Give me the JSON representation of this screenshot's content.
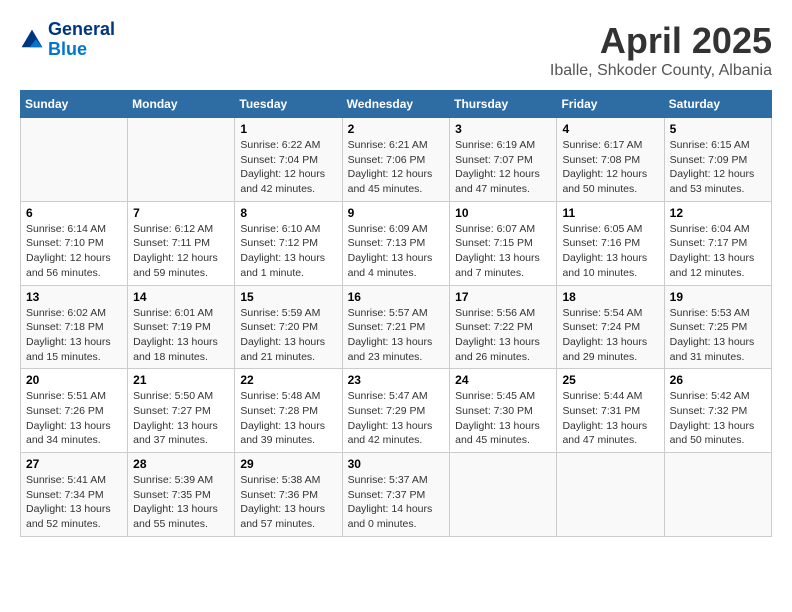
{
  "logo": {
    "line1": "General",
    "line2": "Blue"
  },
  "title": "April 2025",
  "location": "Iballe, Shkoder County, Albania",
  "days_header": [
    "Sunday",
    "Monday",
    "Tuesday",
    "Wednesday",
    "Thursday",
    "Friday",
    "Saturday"
  ],
  "weeks": [
    [
      {
        "day": "",
        "info": ""
      },
      {
        "day": "",
        "info": ""
      },
      {
        "day": "1",
        "info": "Sunrise: 6:22 AM\nSunset: 7:04 PM\nDaylight: 12 hours and 42 minutes."
      },
      {
        "day": "2",
        "info": "Sunrise: 6:21 AM\nSunset: 7:06 PM\nDaylight: 12 hours and 45 minutes."
      },
      {
        "day": "3",
        "info": "Sunrise: 6:19 AM\nSunset: 7:07 PM\nDaylight: 12 hours and 47 minutes."
      },
      {
        "day": "4",
        "info": "Sunrise: 6:17 AM\nSunset: 7:08 PM\nDaylight: 12 hours and 50 minutes."
      },
      {
        "day": "5",
        "info": "Sunrise: 6:15 AM\nSunset: 7:09 PM\nDaylight: 12 hours and 53 minutes."
      }
    ],
    [
      {
        "day": "6",
        "info": "Sunrise: 6:14 AM\nSunset: 7:10 PM\nDaylight: 12 hours and 56 minutes."
      },
      {
        "day": "7",
        "info": "Sunrise: 6:12 AM\nSunset: 7:11 PM\nDaylight: 12 hours and 59 minutes."
      },
      {
        "day": "8",
        "info": "Sunrise: 6:10 AM\nSunset: 7:12 PM\nDaylight: 13 hours and 1 minute."
      },
      {
        "day": "9",
        "info": "Sunrise: 6:09 AM\nSunset: 7:13 PM\nDaylight: 13 hours and 4 minutes."
      },
      {
        "day": "10",
        "info": "Sunrise: 6:07 AM\nSunset: 7:15 PM\nDaylight: 13 hours and 7 minutes."
      },
      {
        "day": "11",
        "info": "Sunrise: 6:05 AM\nSunset: 7:16 PM\nDaylight: 13 hours and 10 minutes."
      },
      {
        "day": "12",
        "info": "Sunrise: 6:04 AM\nSunset: 7:17 PM\nDaylight: 13 hours and 12 minutes."
      }
    ],
    [
      {
        "day": "13",
        "info": "Sunrise: 6:02 AM\nSunset: 7:18 PM\nDaylight: 13 hours and 15 minutes."
      },
      {
        "day": "14",
        "info": "Sunrise: 6:01 AM\nSunset: 7:19 PM\nDaylight: 13 hours and 18 minutes."
      },
      {
        "day": "15",
        "info": "Sunrise: 5:59 AM\nSunset: 7:20 PM\nDaylight: 13 hours and 21 minutes."
      },
      {
        "day": "16",
        "info": "Sunrise: 5:57 AM\nSunset: 7:21 PM\nDaylight: 13 hours and 23 minutes."
      },
      {
        "day": "17",
        "info": "Sunrise: 5:56 AM\nSunset: 7:22 PM\nDaylight: 13 hours and 26 minutes."
      },
      {
        "day": "18",
        "info": "Sunrise: 5:54 AM\nSunset: 7:24 PM\nDaylight: 13 hours and 29 minutes."
      },
      {
        "day": "19",
        "info": "Sunrise: 5:53 AM\nSunset: 7:25 PM\nDaylight: 13 hours and 31 minutes."
      }
    ],
    [
      {
        "day": "20",
        "info": "Sunrise: 5:51 AM\nSunset: 7:26 PM\nDaylight: 13 hours and 34 minutes."
      },
      {
        "day": "21",
        "info": "Sunrise: 5:50 AM\nSunset: 7:27 PM\nDaylight: 13 hours and 37 minutes."
      },
      {
        "day": "22",
        "info": "Sunrise: 5:48 AM\nSunset: 7:28 PM\nDaylight: 13 hours and 39 minutes."
      },
      {
        "day": "23",
        "info": "Sunrise: 5:47 AM\nSunset: 7:29 PM\nDaylight: 13 hours and 42 minutes."
      },
      {
        "day": "24",
        "info": "Sunrise: 5:45 AM\nSunset: 7:30 PM\nDaylight: 13 hours and 45 minutes."
      },
      {
        "day": "25",
        "info": "Sunrise: 5:44 AM\nSunset: 7:31 PM\nDaylight: 13 hours and 47 minutes."
      },
      {
        "day": "26",
        "info": "Sunrise: 5:42 AM\nSunset: 7:32 PM\nDaylight: 13 hours and 50 minutes."
      }
    ],
    [
      {
        "day": "27",
        "info": "Sunrise: 5:41 AM\nSunset: 7:34 PM\nDaylight: 13 hours and 52 minutes."
      },
      {
        "day": "28",
        "info": "Sunrise: 5:39 AM\nSunset: 7:35 PM\nDaylight: 13 hours and 55 minutes."
      },
      {
        "day": "29",
        "info": "Sunrise: 5:38 AM\nSunset: 7:36 PM\nDaylight: 13 hours and 57 minutes."
      },
      {
        "day": "30",
        "info": "Sunrise: 5:37 AM\nSunset: 7:37 PM\nDaylight: 14 hours and 0 minutes."
      },
      {
        "day": "",
        "info": ""
      },
      {
        "day": "",
        "info": ""
      },
      {
        "day": "",
        "info": ""
      }
    ]
  ]
}
